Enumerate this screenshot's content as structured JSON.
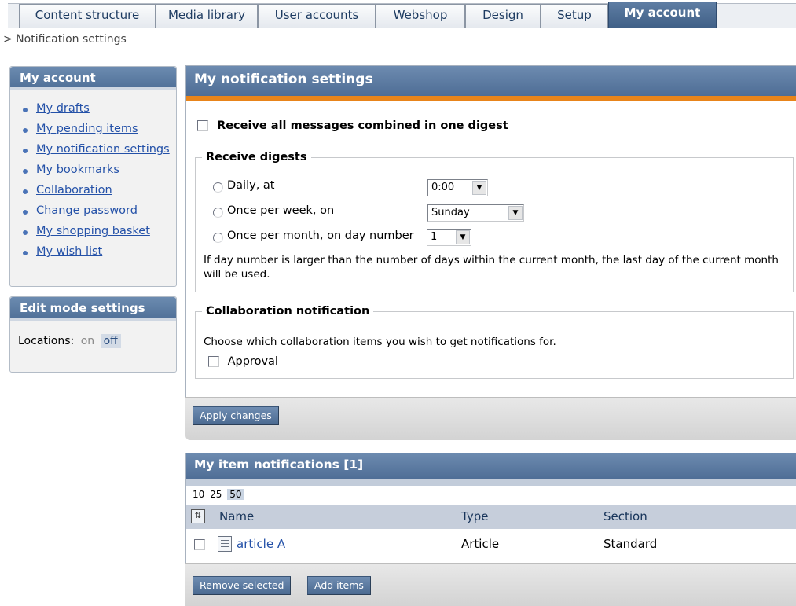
{
  "tabs": [
    {
      "label": "Content structure"
    },
    {
      "label": "Media library"
    },
    {
      "label": "User accounts"
    },
    {
      "label": "Webshop"
    },
    {
      "label": "Design"
    },
    {
      "label": "Setup"
    },
    {
      "label": "My account"
    }
  ],
  "breadcrumb": "> Notification settings",
  "sidebar": {
    "title": "My account",
    "items": [
      {
        "label": "My drafts"
      },
      {
        "label": "My pending items"
      },
      {
        "label": "My notification settings"
      },
      {
        "label": "My bookmarks"
      },
      {
        "label": "Collaboration"
      },
      {
        "label": "Change password"
      },
      {
        "label": "My shopping basket"
      },
      {
        "label": "My wish list"
      }
    ],
    "edit_mode": {
      "title": "Edit mode settings",
      "locations_label": "Locations:",
      "on": "on",
      "off": "off"
    }
  },
  "notification_settings": {
    "title": "My notification settings",
    "digest_checkbox_label": "Receive all messages combined in one digest",
    "receive_digests": {
      "legend": "Receive digests",
      "daily_label": "Daily, at",
      "daily_value": "0:00",
      "weekly_label": "Once per week, on",
      "weekly_value": "Sunday",
      "monthly_label": "Once per month, on day number",
      "monthly_value": "1",
      "note": "If day number is larger than the number of days within the current month, the last day of the current month will be used."
    },
    "collaboration": {
      "legend": "Collaboration notification",
      "description": "Choose which collaboration items you wish to get notifications for.",
      "approval_label": "Approval"
    },
    "apply_button": "Apply changes"
  },
  "item_notifications": {
    "title": "My item notifications [1]",
    "page_sizes": [
      "10",
      "25",
      "50"
    ],
    "selected_page_size": "50",
    "columns": {
      "name": "Name",
      "type": "Type",
      "section": "Section"
    },
    "rows": [
      {
        "name": "article A",
        "type": "Article",
        "section": "Standard"
      }
    ],
    "remove_button": "Remove selected",
    "add_button": "Add items"
  }
}
